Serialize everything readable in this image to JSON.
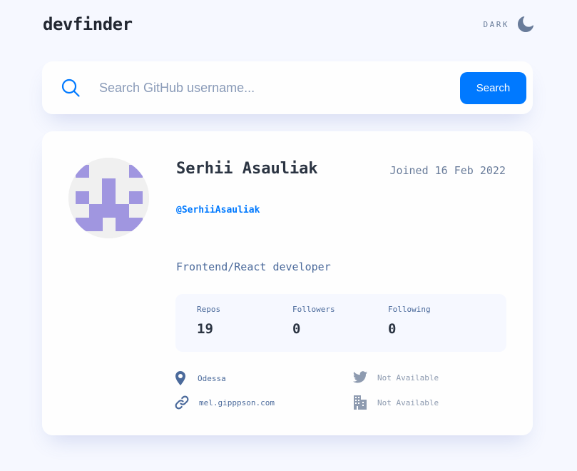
{
  "header": {
    "logo": "devfinder",
    "theme_label": "DARK",
    "theme_icon": "moon-icon"
  },
  "search": {
    "placeholder": "Search GitHub username...",
    "value": "",
    "button_label": "Search",
    "icon": "search-icon"
  },
  "profile": {
    "name": "Serhii Asauliak",
    "joined": "Joined 16 Feb 2022",
    "login": "@SerhiiAsauliak",
    "bio": "Frontend/React developer",
    "avatar": "identicon-avatar",
    "stats": [
      {
        "label": "Repos",
        "value": "19"
      },
      {
        "label": "Followers",
        "value": "0"
      },
      {
        "label": "Following",
        "value": "0"
      }
    ],
    "links": {
      "location": "Odessa",
      "blog": "mel.gipppson.com",
      "twitter": "Not Available",
      "company": "Not Available"
    }
  },
  "colors": {
    "background": "#f6f8ff",
    "card": "#fefefe",
    "accent": "#0079ff",
    "heading": "#2b3442",
    "text": "#4b6a9b",
    "muted": "#8e9bb0",
    "avatar_fg": "#a096e0",
    "avatar_bg": "#f0f0f0"
  }
}
